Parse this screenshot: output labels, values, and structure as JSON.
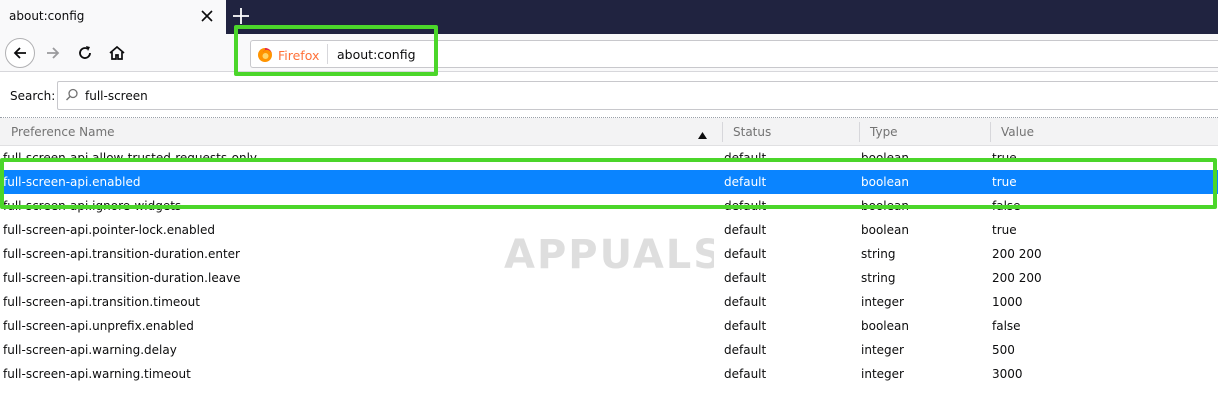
{
  "tab": {
    "title": "about:config",
    "close_icon": "close-icon"
  },
  "newtab": {
    "icon": "plus-icon"
  },
  "toolbar": {
    "back_icon": "arrow-left-icon",
    "forward_icon": "arrow-right-icon",
    "reload_icon": "reload-icon",
    "home_icon": "home-icon"
  },
  "urlbar": {
    "identity_label": "Firefox",
    "url": "about:config"
  },
  "search": {
    "label": "Search:",
    "value": "full-screen"
  },
  "table": {
    "columns": [
      "Preference Name",
      "Status",
      "Type",
      "Value"
    ],
    "sort": "descending",
    "rows": [
      {
        "name": "full-screen-api.allow-trusted-requests-only",
        "status": "default",
        "type": "boolean",
        "value": "true"
      },
      {
        "name": "full-screen-api.enabled",
        "status": "default",
        "type": "boolean",
        "value": "true",
        "selected": true
      },
      {
        "name": "full-screen-api.ignore-widgets",
        "status": "default",
        "type": "boolean",
        "value": "false"
      },
      {
        "name": "full-screen-api.pointer-lock.enabled",
        "status": "default",
        "type": "boolean",
        "value": "true"
      },
      {
        "name": "full-screen-api.transition-duration.enter",
        "status": "default",
        "type": "string",
        "value": "200 200"
      },
      {
        "name": "full-screen-api.transition-duration.leave",
        "status": "default",
        "type": "string",
        "value": "200 200"
      },
      {
        "name": "full-screen-api.transition.timeout",
        "status": "default",
        "type": "integer",
        "value": "1000"
      },
      {
        "name": "full-screen-api.unprefix.enabled",
        "status": "default",
        "type": "boolean",
        "value": "false"
      },
      {
        "name": "full-screen-api.warning.delay",
        "status": "default",
        "type": "integer",
        "value": "500"
      },
      {
        "name": "full-screen-api.warning.timeout",
        "status": "default",
        "type": "integer",
        "value": "3000"
      }
    ]
  },
  "colors": {
    "selection": "#0a84ff",
    "highlight": "#4bd62a",
    "tabstrip": "#202340",
    "firefox": "#ff7139"
  },
  "watermark": {
    "text": "APPUALS"
  }
}
